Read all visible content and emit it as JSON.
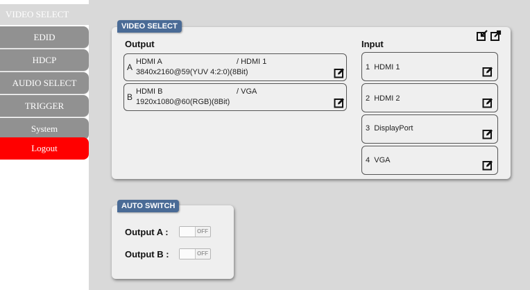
{
  "sidebar": {
    "items": [
      {
        "label": "VIDEO SELECT"
      },
      {
        "label": "EDID"
      },
      {
        "label": "HDCP"
      },
      {
        "label": "AUDIO SELECT"
      },
      {
        "label": "TRIGGER"
      },
      {
        "label": "System"
      },
      {
        "label": "Logout"
      }
    ]
  },
  "video_select": {
    "tag": "VIDEO SELECT",
    "output_title": "Output",
    "input_title": "Input",
    "outputs": [
      {
        "letter": "A",
        "name": "HDMI A",
        "source": "/ HDMI 1",
        "format": "3840x2160@59(YUV 4:2:0)(8Bit)"
      },
      {
        "letter": "B",
        "name": "HDMI B",
        "source": "/ VGA",
        "format": "1920x1080@60(RGB)(8Bit)"
      }
    ],
    "inputs": [
      {
        "label": "1  HDMI 1"
      },
      {
        "label": "2  HDMI 2"
      },
      {
        "label": "3  DisplayPort"
      },
      {
        "label": "4  VGA"
      }
    ]
  },
  "auto_switch": {
    "tag": "AUTO SWITCH",
    "rows": [
      {
        "label": "Output A :",
        "state": "OFF"
      },
      {
        "label": "Output B :",
        "state": "OFF"
      }
    ]
  },
  "colors": {
    "nav_grey": "#919191",
    "nav_active": "#d9d9d9",
    "logout": "#ff0000",
    "tag_blue": "#4a6b96",
    "background": "#d9d9d9"
  }
}
